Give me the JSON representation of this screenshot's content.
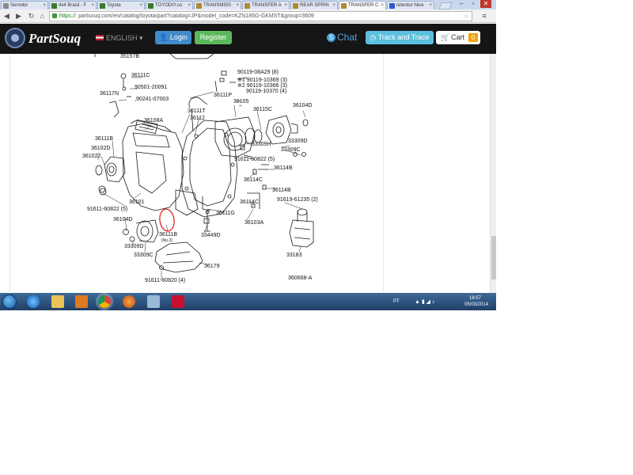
{
  "browser": {
    "tabs": [
      {
        "label": "Servidor",
        "color": "#8a8a8a"
      },
      {
        "label": "4x4 Brasil - F",
        "color": "#3b7a2a"
      },
      {
        "label": "Toyota",
        "color": "#3b7a2a"
      },
      {
        "label": "TOYODIY.co",
        "color": "#3b7a2a"
      },
      {
        "label": "TRANSMISS",
        "color": "#b08830"
      },
      {
        "label": "TRANSFER A",
        "color": "#b08830"
      },
      {
        "label": "REAR SPRIN",
        "color": "#b08830"
      },
      {
        "label": "TRANSFER C",
        "color": "#b08830"
      },
      {
        "label": "retentor hilux",
        "color": "#3355cc"
      }
    ],
    "active_tab_index": 7,
    "url_scheme": "https://",
    "url_rest": "partsouq.com/en/catalog/toyota/part?catalog=JP&model_code=KZN185G-GKMST&group=3609"
  },
  "site": {
    "logo": "PartSouq",
    "language": "ENGLISH",
    "login": "Login",
    "register": "Register",
    "chat": "Chat",
    "track": "Track and Trace",
    "cart": "Cart",
    "cart_count": "0"
  },
  "diagram": {
    "labels": [
      "36111C",
      "35157B",
      "90501-20091",
      "90241-07003",
      "36117N",
      "90119-08A29 (8)",
      "※1 90119-10369 (3)",
      "※2 90119-10366 (3)",
      "90119-10370 (4)",
      "36111P",
      "36105",
      "36104D",
      "36108A",
      "36111T",
      "36112",
      "36115C",
      "36111B",
      "36102D",
      "36102J",
      "33309H",
      "33309D",
      "33309C",
      "91611-60822 (5)",
      "36114B",
      "36114C",
      "36114B",
      "91619-61235 (2)",
      "36101",
      "36114C",
      "91611-60822 (5)",
      "36111G",
      "36104D",
      "36103A",
      "36111B",
      "(No.2)",
      "33449D",
      "33309D",
      "33309C",
      "33183",
      "36179",
      "91611-60820 (4)",
      "360668-A"
    ]
  },
  "taskbar": {
    "lang": "PT",
    "time": "18:57",
    "date": "05/03/2014"
  }
}
